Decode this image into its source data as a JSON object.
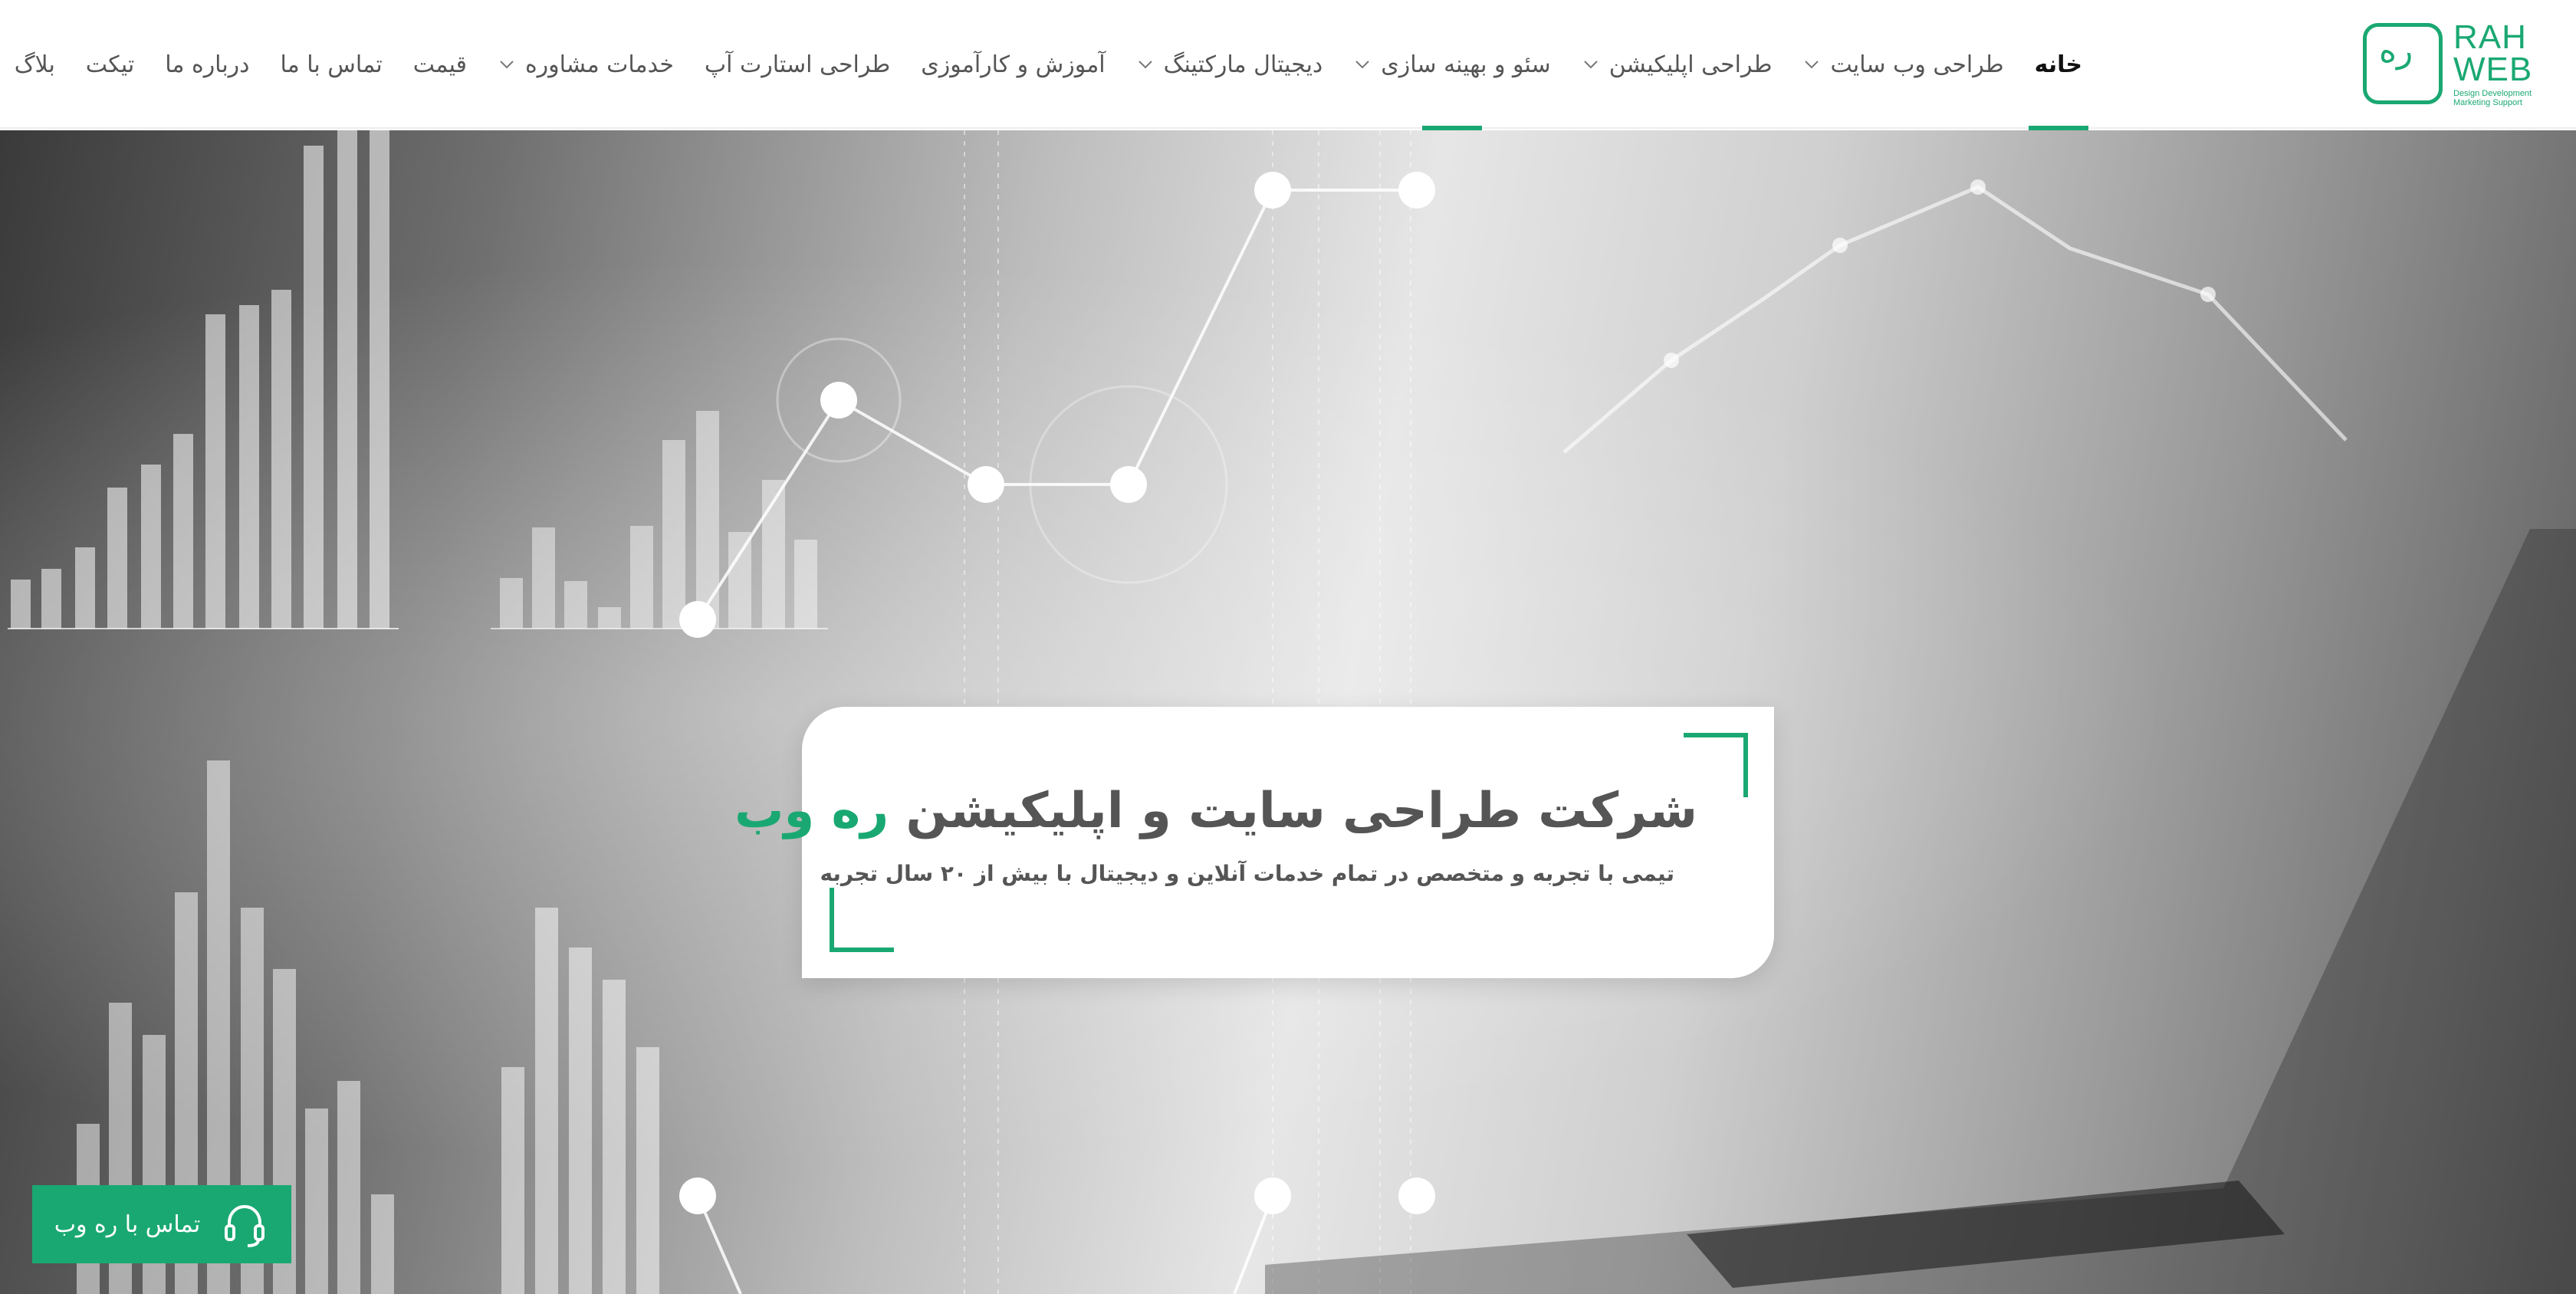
{
  "brand": {
    "logo_glyph": "ره",
    "logo_title": "RAH\nWEB",
    "logo_tagline": "Design Development Marketing Support",
    "accent_color": "#1aa872"
  },
  "nav": {
    "items": [
      {
        "label": "خانه",
        "active": true,
        "has_dropdown": false
      },
      {
        "label": "طراحی وب سایت",
        "active": false,
        "has_dropdown": true
      },
      {
        "label": "طراحی اپلیکیشن",
        "active": false,
        "has_dropdown": true
      },
      {
        "label": "سئو و بهینه سازی",
        "active": false,
        "has_dropdown": true
      },
      {
        "label": "دیجیتال مارکتینگ",
        "active": false,
        "has_dropdown": true
      },
      {
        "label": "آموزش و کارآموزی",
        "active": false,
        "has_dropdown": false
      },
      {
        "label": "طراحی استارت آپ",
        "active": false,
        "has_dropdown": false
      },
      {
        "label": "خدمات مشاوره",
        "active": false,
        "has_dropdown": true
      },
      {
        "label": "قیمت",
        "active": false,
        "has_dropdown": false
      },
      {
        "label": "تماس با ما",
        "active": false,
        "has_dropdown": false
      },
      {
        "label": "درباره ما",
        "active": false,
        "has_dropdown": false
      },
      {
        "label": "تیکت",
        "active": false,
        "has_dropdown": false
      },
      {
        "label": "بلاگ",
        "active": false,
        "has_dropdown": false
      }
    ]
  },
  "hero": {
    "title_main": "شرکت طراحی سایت و اپلیکیشن ",
    "title_accent": "ره وب",
    "subtitle": "تیمی با تجربه و متخصص در تمام خدمات آنلاین و دیجیتال با بیش از ۲۰ سال تجربه",
    "background_image": "grayscale photo of a person typing on a laptop with chart overlays"
  },
  "contact_button": {
    "label": "تماس با ره وب",
    "icon": "headset-icon"
  }
}
